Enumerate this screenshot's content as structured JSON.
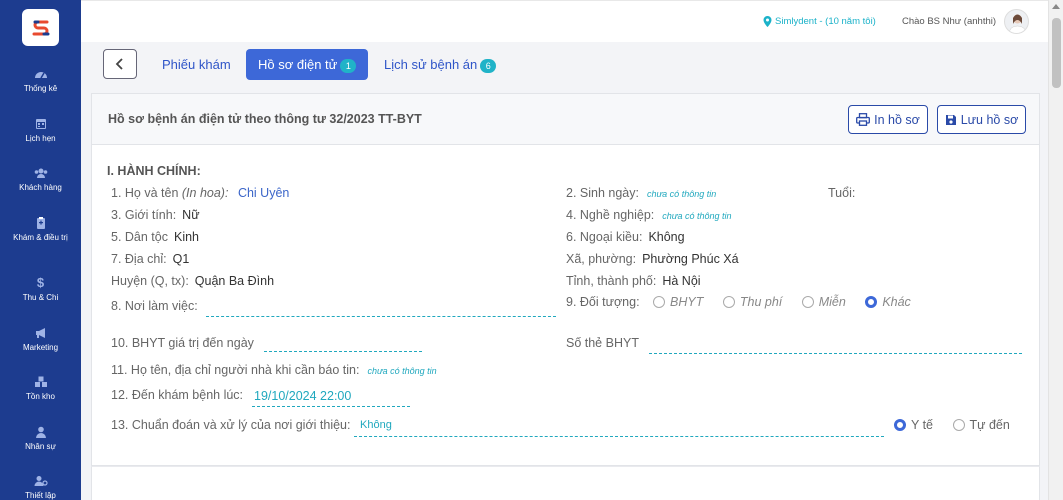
{
  "sidebar": {
    "items": [
      {
        "label": "Thống kê",
        "icon": "dashboard-icon"
      },
      {
        "label": "Lịch hẹn",
        "icon": "calendar-icon"
      },
      {
        "label": "Khách hàng",
        "icon": "users-icon"
      },
      {
        "label": "Khám & điều trị",
        "icon": "clipboard-icon"
      },
      {
        "label": "Thu & Chi",
        "icon": "dollar-icon"
      },
      {
        "label": "Marketing",
        "icon": "megaphone-icon"
      },
      {
        "label": "Tồn kho",
        "icon": "boxes-icon"
      },
      {
        "label": "Nhân sự",
        "icon": "person-icon"
      },
      {
        "label": "Thiết lập",
        "icon": "settings-users-icon"
      }
    ]
  },
  "topbar": {
    "location": "Simlydent - (10 năm tôi)",
    "greeting": "Chào BS Như (anhthi)"
  },
  "tabs": [
    {
      "label": "Phiếu khám",
      "badge": ""
    },
    {
      "label": "Hồ sơ điện tử",
      "badge": "1"
    },
    {
      "label": "Lịch sử bệnh án",
      "badge": "6"
    }
  ],
  "card": {
    "title": "Hồ sơ bệnh án điện tử theo thông tư 32/2023 TT-BYT",
    "print_label": "In hồ sơ",
    "save_label": "Lưu hồ sơ"
  },
  "form": {
    "section": "I. HÀNH CHÍNH:",
    "name_label": "1. Họ và tên",
    "name_hint": "(In hoa):",
    "name_value": "Chi Uyên",
    "dob_label": "2. Sinh ngày:",
    "dob_value": "chưa có thông tin",
    "age_label": "Tuổi:",
    "gender_label": "3. Giới tính:",
    "gender_value": "Nữ",
    "job_label": "4. Nghề nghiệp:",
    "job_value": "chưa có thông tin",
    "ethnic_label": "5. Dân tộc",
    "ethnic_value": "Kinh",
    "foreign_label": "6. Ngoại kiều:",
    "foreign_value": "Không",
    "address_label": "7. Địa chỉ:",
    "address_value": "Q1",
    "ward_label": "Xã, phường:",
    "ward_value": "Phường Phúc Xá",
    "district_label": "Huyện (Q, tx):",
    "district_value": "Quận Ba Đình",
    "province_label": "Tỉnh, thành phố:",
    "province_value": "Hà Nội",
    "workplace_label": "8. Nơi làm việc:",
    "object_label": "9. Đối tượng:",
    "object_options": [
      "BHYT",
      "Thu phí",
      "Miễn",
      "Khác"
    ],
    "object_selected": "Khác",
    "bhyt_date_label": "10. BHYT giá trị đến ngày",
    "bhyt_card_label": "Số thẻ BHYT",
    "relative_label": "11. Họ tên, địa chỉ người nhà khi cần báo tin:",
    "relative_value": "chưa có thông tin",
    "visit_label": "12. Đến khám bệnh lúc:",
    "visit_value": "19/10/2024 22:00",
    "referral_label": "13. Chuẩn đoán và xử lý của nơi giới thiệu:",
    "referral_value": "Không",
    "referral_options": [
      "Y tế",
      "Tự đến"
    ],
    "referral_selected": "Y tế"
  },
  "colors": {
    "sidebar": "#1d3c8f",
    "primary": "#3d68d8",
    "accent": "#20a8be"
  }
}
